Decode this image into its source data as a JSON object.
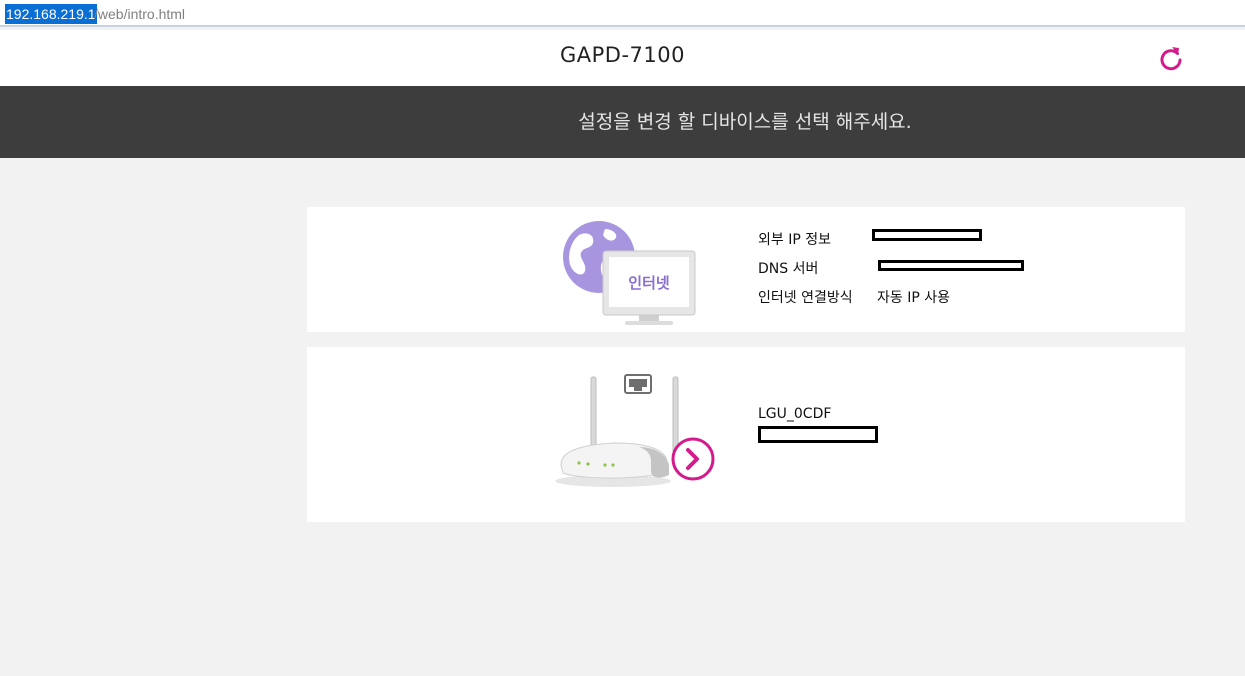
{
  "browser": {
    "url_host": "192.168.219.1",
    "url_path": "/web/intro.html"
  },
  "header": {
    "title": "GAPD-7100",
    "refresh_icon": "refresh-icon",
    "accent_color": "#d41b8c"
  },
  "banner": {
    "text": "설정을 변경 할 디바이스를 선택 해주세요."
  },
  "internet_card": {
    "illustration_label": "인터넷",
    "rows": [
      {
        "label": "외부 IP 정보",
        "value": ""
      },
      {
        "label": "DNS 서버",
        "value": ""
      },
      {
        "label": "인터넷 연결방식",
        "value": "자동 IP 사용"
      }
    ]
  },
  "router_card": {
    "name": "LGU_0CDF",
    "icons": [
      "router-icon",
      "ethernet-port-icon",
      "arrow-right-circle-icon"
    ]
  },
  "colors": {
    "banner_bg": "#3d3d3d",
    "page_bg": "#f2f2f2",
    "accent": "#d41b8c",
    "globe": "#a895e0"
  }
}
